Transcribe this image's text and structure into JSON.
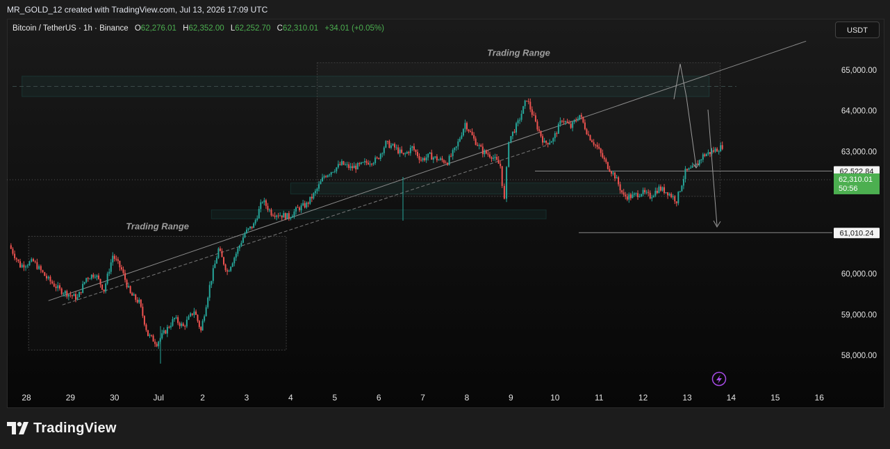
{
  "caption": "MR_GOLD_12 created with TradingView.com, Jul 13, 2026 17:09 UTC",
  "legend": {
    "symbol": "Bitcoin / TetherUS · 1h · Binance",
    "o_label": "O",
    "o_value": "62,276.01",
    "h_label": "H",
    "h_value": "62,352.00",
    "l_label": "L",
    "l_value": "62,252.70",
    "c_label": "C",
    "c_value": "62,310.01",
    "change": "+34.01 (+0.05%)"
  },
  "currency": "USDT",
  "brand": "TradingView",
  "colors": {
    "up": "#26a69a",
    "up_bright": "#4caf50",
    "down": "#ef5350",
    "background": "#121212",
    "price_tag": "#4caf50"
  },
  "chart_data": {
    "type": "candlestick",
    "x_ticks": [
      "28",
      "29",
      "30",
      "Jul",
      "2",
      "3",
      "4",
      "5",
      "6",
      "7",
      "8",
      "9",
      "10",
      "11",
      "12",
      "13",
      "14",
      "15",
      "16"
    ],
    "y_ticks": [
      "65,000.00",
      "64,000.00",
      "63,000.00",
      "60,000.00",
      "59,000.00",
      "58,000.00"
    ],
    "ylim": [
      57500,
      66300
    ],
    "current_price": {
      "value": 62310.01,
      "label": "62,310.01",
      "countdown": "50:56"
    },
    "levels": [
      {
        "value": 62522.84,
        "label": "62,522.84"
      },
      {
        "value": 61010.24,
        "label": 61010.24,
        "label_text": "61,010.24"
      }
    ],
    "annotations": [
      {
        "text": "Trading Range",
        "x_from": 28.05,
        "x_to": 3.9,
        "y_from": 58130,
        "y_to": 60920
      },
      {
        "text": "Trading Range",
        "x_from": 4.6,
        "x_to": 13.75,
        "y_from": 61900,
        "y_to": 65180
      }
    ],
    "zones": [
      {
        "x_from": 27.9,
        "x_to": 13.5,
        "y_from": 64350,
        "y_to": 64850
      },
      {
        "x_from": 2.2,
        "x_to": 9.8,
        "y_from": 61350,
        "y_to": 61570
      },
      {
        "x_from": 4.0,
        "x_to": 12.3,
        "y_from": 61960,
        "y_to": 62230
      }
    ],
    "trendline": {
      "x_from": 28.5,
      "y_from": 59340,
      "x_to": 15.7,
      "y_to": 65710
    },
    "candles_path_keypoints": [
      [
        27.65,
        60700
      ],
      [
        27.9,
        60200
      ],
      [
        28.2,
        60300
      ],
      [
        28.5,
        59900
      ],
      [
        28.8,
        59600
      ],
      [
        29.0,
        59500
      ],
      [
        29.2,
        59400
      ],
      [
        29.4,
        59900
      ],
      [
        29.6,
        60000
      ],
      [
        29.8,
        59600
      ],
      [
        30.0,
        60450
      ],
      [
        30.2,
        60100
      ],
      [
        30.4,
        59500
      ],
      [
        30.6,
        59300
      ],
      [
        30.8,
        58500
      ],
      [
        31.0,
        58300
      ],
      [
        31.2,
        58600
      ],
      [
        31.4,
        58900
      ],
      [
        31.6,
        58700
      ],
      [
        31.85,
        59100
      ],
      [
        32.0,
        58600
      ],
      [
        32.2,
        59700
      ],
      [
        32.4,
        60600
      ],
      [
        32.6,
        60050
      ],
      [
        32.8,
        60500
      ],
      [
        33.0,
        61000
      ],
      [
        33.2,
        61200
      ],
      [
        33.4,
        61800
      ],
      [
        33.6,
        61500
      ],
      [
        33.8,
        61450
      ],
      [
        34.0,
        61400
      ],
      [
        34.2,
        61600
      ],
      [
        34.4,
        61700
      ],
      [
        34.6,
        62000
      ],
      [
        34.8,
        62400
      ],
      [
        35.0,
        62550
      ],
      [
        35.2,
        62700
      ],
      [
        35.4,
        62600
      ],
      [
        35.6,
        62650
      ],
      [
        35.8,
        62750
      ],
      [
        36.0,
        62800
      ],
      [
        36.2,
        63200
      ],
      [
        36.4,
        63100
      ],
      [
        36.6,
        62900
      ],
      [
        36.8,
        63100
      ],
      [
        37.0,
        62800
      ],
      [
        37.2,
        62900
      ],
      [
        37.4,
        62800
      ],
      [
        37.6,
        62750
      ],
      [
        37.8,
        63100
      ],
      [
        38.0,
        63700
      ],
      [
        38.2,
        63300
      ],
      [
        38.4,
        63000
      ],
      [
        38.6,
        62900
      ],
      [
        38.8,
        62650
      ],
      [
        38.9,
        61800
      ],
      [
        39.0,
        63300
      ],
      [
        39.2,
        63700
      ],
      [
        39.4,
        64300
      ],
      [
        39.6,
        63700
      ],
      [
        39.8,
        63200
      ],
      [
        40.0,
        63300
      ],
      [
        40.2,
        63800
      ],
      [
        40.4,
        63600
      ],
      [
        40.6,
        63900
      ],
      [
        40.8,
        63400
      ],
      [
        41.0,
        63100
      ],
      [
        41.2,
        62700
      ],
      [
        41.4,
        62400
      ],
      [
        41.6,
        61900
      ],
      [
        41.8,
        61900
      ],
      [
        42.0,
        62000
      ],
      [
        42.2,
        61900
      ],
      [
        42.4,
        62100
      ],
      [
        42.6,
        62000
      ],
      [
        42.8,
        61800
      ],
      [
        43.0,
        62500
      ],
      [
        43.2,
        62600
      ],
      [
        43.4,
        62900
      ],
      [
        43.6,
        63000
      ],
      [
        43.8,
        63100
      ],
      [
        44.0,
        63300
      ],
      [
        44.2,
        63800
      ],
      [
        44.4,
        64100
      ],
      [
        44.6,
        64200
      ],
      [
        44.8,
        64300
      ],
      [
        45.0,
        64200
      ],
      [
        45.2,
        63800
      ],
      [
        45.4,
        64000
      ],
      [
        45.6,
        64100
      ],
      [
        45.8,
        64200
      ],
      [
        46.0,
        64250
      ],
      [
        46.2,
        64100
      ],
      [
        46.4,
        64300
      ],
      [
        46.6,
        64200
      ],
      [
        46.8,
        64000
      ],
      [
        47.0,
        63900
      ],
      [
        47.2,
        64100
      ],
      [
        47.4,
        64000
      ],
      [
        47.6,
        63900
      ],
      [
        47.8,
        64200
      ],
      [
        48.0,
        64100
      ],
      [
        48.2,
        64300
      ],
      [
        48.4,
        64200
      ],
      [
        48.6,
        63700
      ],
      [
        48.8,
        62800
      ],
      [
        49.0,
        62600
      ],
      [
        49.2,
        62800
      ],
      [
        49.4,
        63100
      ],
      [
        49.6,
        62700
      ],
      [
        49.8,
        62300
      ]
    ],
    "marker_legend": [
      "up candle",
      "down candle"
    ]
  }
}
